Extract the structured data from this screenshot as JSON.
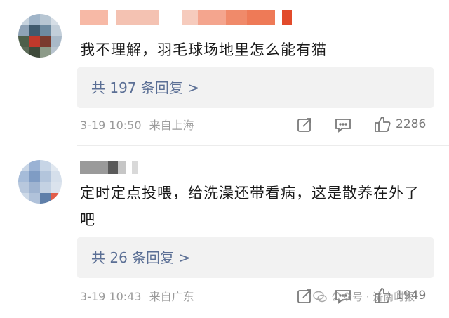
{
  "comments": [
    {
      "text": "我不理解，羽毛球场地里怎么能有猫",
      "reply_label": "共 197 条回复 >",
      "date": "3-19 10:50",
      "location": "来自上海",
      "like_count": "2286"
    },
    {
      "text": "定时定点投喂，给洗澡还带看病，这是散养在外了吧",
      "reply_label": "共 26 条回复 >",
      "date": "3-19 10:43",
      "location": "来自广东",
      "like_count": "1949"
    }
  ],
  "icons": {
    "share": "share-icon",
    "comment": "comment-icon",
    "like": "thumbs-up-icon"
  },
  "watermark": "公众号 · 济南时报",
  "colors": {
    "reply_link": "#5b6f95",
    "meta_gray": "#9a9a9a"
  }
}
